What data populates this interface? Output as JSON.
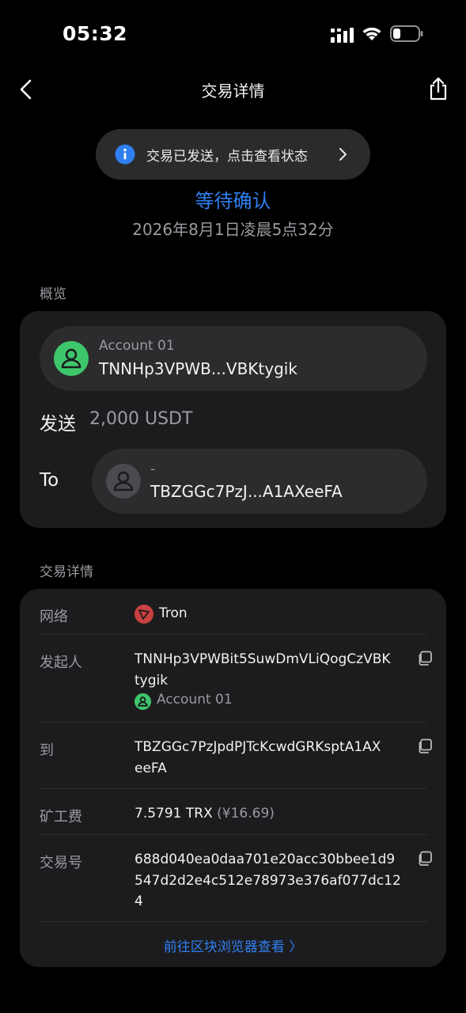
{
  "status_bar": {
    "time": "05:32"
  },
  "header": {
    "title": "交易详情"
  },
  "notice": {
    "text": "交易已发送，点击查看状态"
  },
  "tx_status": {
    "label": "等待确认",
    "datetime": "2026年8月1日凌晨5点32分"
  },
  "overview": {
    "section_label": "概览",
    "from": {
      "name": "Account 01",
      "address": "TNNHp3VPWB...VBKtygik"
    },
    "send_label": "发送",
    "amount": "2,000 USDT",
    "to_label": "To",
    "to": {
      "name": "-",
      "address": "TBZGGc7PzJ...A1AXeeFA"
    }
  },
  "details": {
    "section_label": "交易详情",
    "network": {
      "label": "网络",
      "value": "Tron"
    },
    "initiator": {
      "label": "发起人",
      "line1": "TNNHp3VPWBit5SuwDmVLiQogCzVBK",
      "line2": "tygik",
      "account": "Account 01"
    },
    "recipient": {
      "label": "到",
      "line1": "TBZGGc7PzJpdPJTcKcwdGRKsptA1AX",
      "line2": "eeFA"
    },
    "fee": {
      "label": "矿工费",
      "value": "7.5791 TRX",
      "fiat": "(¥16.69)"
    },
    "txid": {
      "label": "交易号",
      "line1": "688d040ea0daa701e20acc30bbee1d9",
      "line2": "547d2d2e4c512e78973e376af077dc12",
      "line3": "4"
    }
  },
  "explorer_link": {
    "label": "前往区块浏览器查看 〉"
  },
  "colors": {
    "accent": "#2f7ff1",
    "success": "#3ec66b",
    "tron": "#c94140",
    "card": "#1c1c1e"
  }
}
